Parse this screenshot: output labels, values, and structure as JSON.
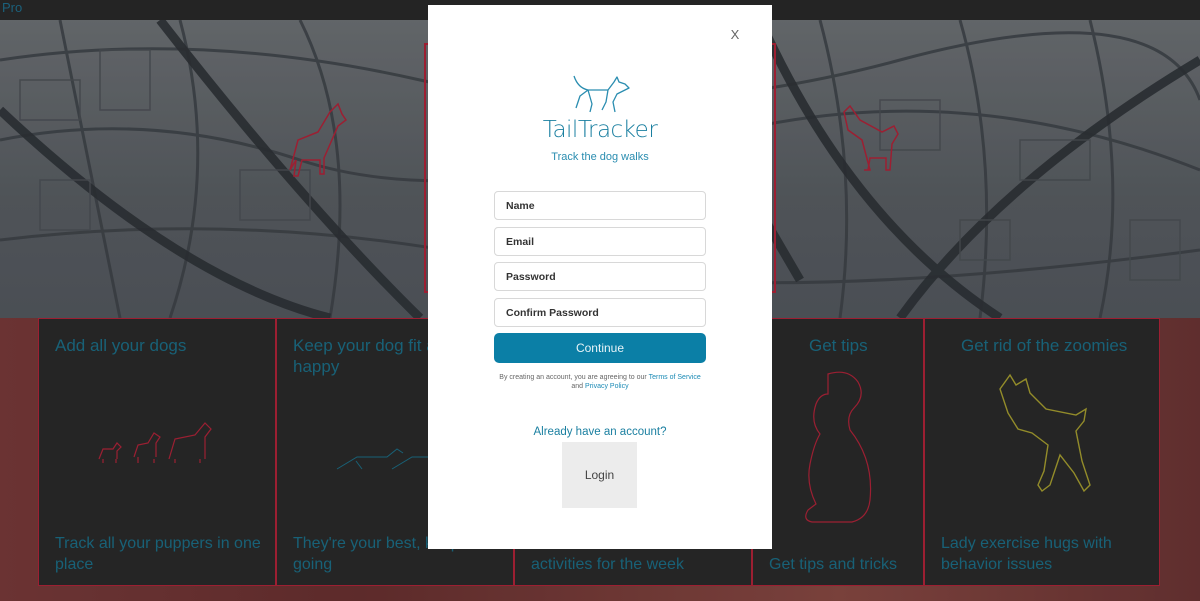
{
  "topbar": {
    "link_text": "Pro"
  },
  "cards": [
    {
      "title": "Add all your dogs",
      "description": "Track all your puppers in one place"
    },
    {
      "title": "Keep your dog fit and happy",
      "description": "They're your best, keep them going"
    },
    {
      "title": "",
      "description": "activities for the week"
    },
    {
      "title": "Get tips",
      "description": "Get tips and tricks"
    },
    {
      "title": "Get rid of the zoomies",
      "description": "Lady exercise hugs with behavior issues"
    }
  ],
  "modal": {
    "close_label": "X",
    "brand": "TailTracker",
    "tagline": "Track the dog walks",
    "fields": {
      "name_placeholder": "Name",
      "email_placeholder": "Email",
      "password_placeholder": "Password",
      "confirm_placeholder": "Confirm Password"
    },
    "continue_label": "Continue",
    "terms_prefix": "By creating an account, you are agreeing to our",
    "terms_link": "Terms of Service",
    "terms_and": "and",
    "privacy_link": "Privacy Policy",
    "already_label": "Already have an account?",
    "login_label": "Login"
  },
  "colors": {
    "accent": "#0b7fa6",
    "border_red": "#b2243a",
    "brand_blue": "#1a7fa0"
  }
}
